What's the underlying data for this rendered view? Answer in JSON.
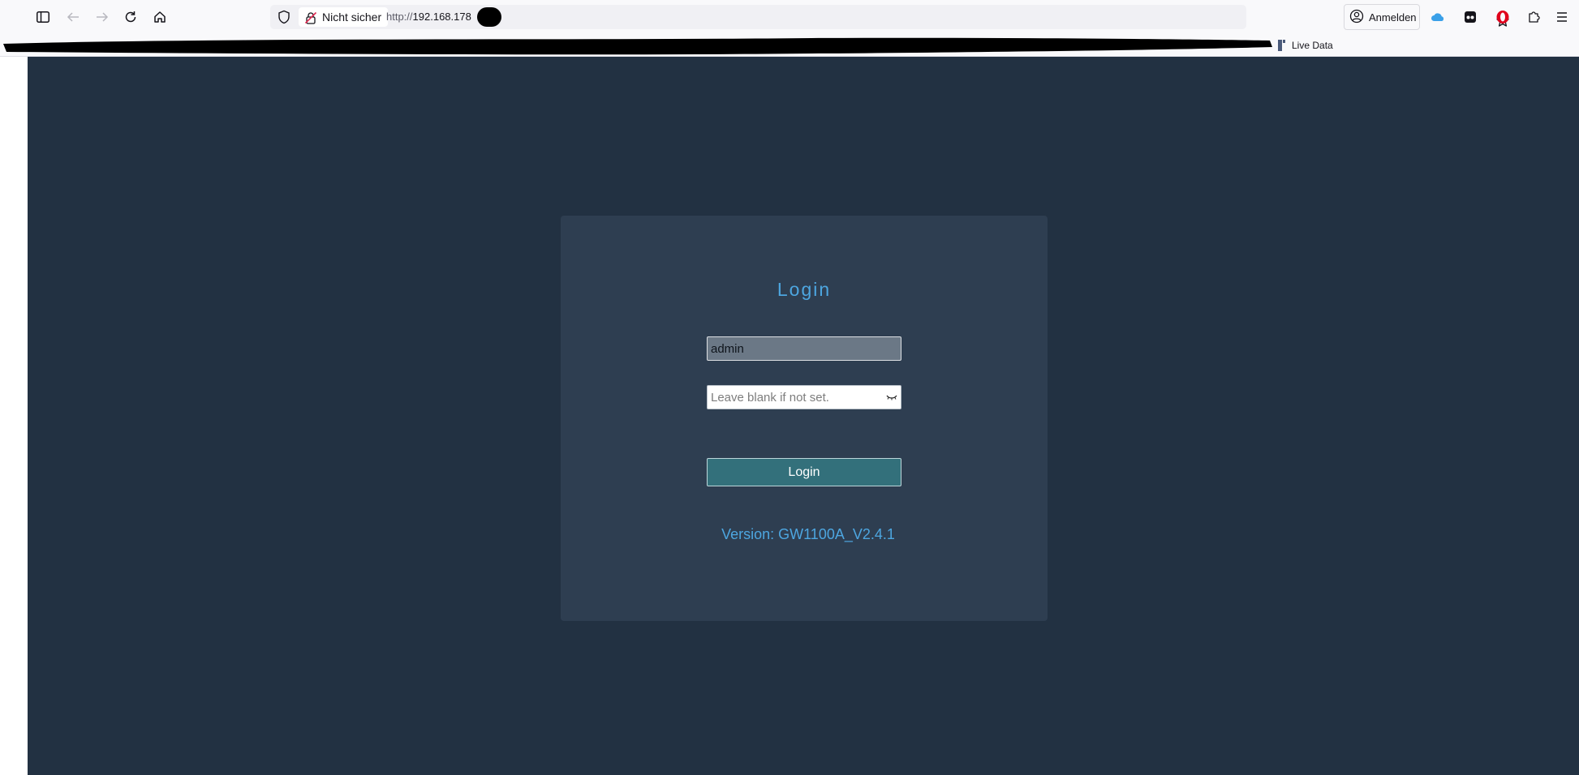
{
  "browser": {
    "security_label": "Nicht sicher",
    "url_scheme": "http://",
    "url_host": "192.168.178",
    "signin_label": "Anmelden",
    "bookmark_live_data": "Live Data"
  },
  "login": {
    "title": "Login",
    "username_value": "admin",
    "password_placeholder": "Leave blank if not set.",
    "button_label": "Login",
    "version_prefix": "Version: ",
    "version_value": "GW1100A_V2.4.1"
  },
  "colors": {
    "page_background": "#223142",
    "card_background": "#2e3e51",
    "accent": "#4da6e0",
    "button": "#33707b"
  },
  "icons": {
    "sidebar": "sidebar-icon",
    "back": "back-arrow-icon",
    "forward": "forward-arrow-icon",
    "reload": "reload-icon",
    "home": "home-icon",
    "shield": "tracking-shield-icon",
    "insecure_lock": "insecure-lock-icon",
    "bookmark_star": "star-icon",
    "account": "account-icon",
    "password_reveal": "eye-icon"
  }
}
